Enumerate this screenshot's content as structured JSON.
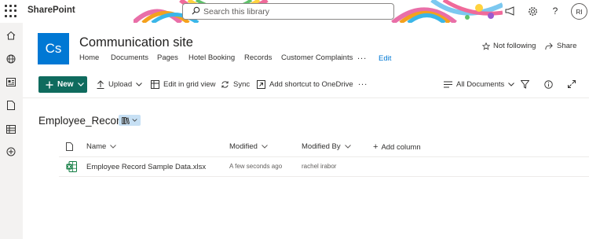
{
  "suite": {
    "app_name": "SharePoint",
    "search_placeholder": "Search this library",
    "user_initials": "RI"
  },
  "site": {
    "logo_text": "Cs",
    "title": "Communication site",
    "nav": [
      "Home",
      "Documents",
      "Pages",
      "Hotel Booking",
      "Records",
      "Customer Complaints"
    ],
    "nav_more": "...",
    "nav_edit": "Edit",
    "not_following": "Not following",
    "share": "Share"
  },
  "commandbar": {
    "new": "New",
    "upload": "Upload",
    "edit_grid": "Edit in grid view",
    "sync": "Sync",
    "add_shortcut": "Add shortcut to OneDrive",
    "more": "...",
    "view": "All Documents"
  },
  "library": {
    "title": "Employee_Record",
    "columns": {
      "name": "Name",
      "modified": "Modified",
      "modified_by": "Modified By",
      "add_column": "Add column"
    },
    "rows": [
      {
        "file_type": "excel-file-icon",
        "name": "Employee Record Sample Data.xlsx",
        "modified": "A few seconds ago",
        "modified_by": "rachel irabor"
      }
    ]
  },
  "colors": {
    "primary_button": "#0f6b5e",
    "site_logo": "#0078d4",
    "link": "#0078d4",
    "excel": "#107c41"
  }
}
